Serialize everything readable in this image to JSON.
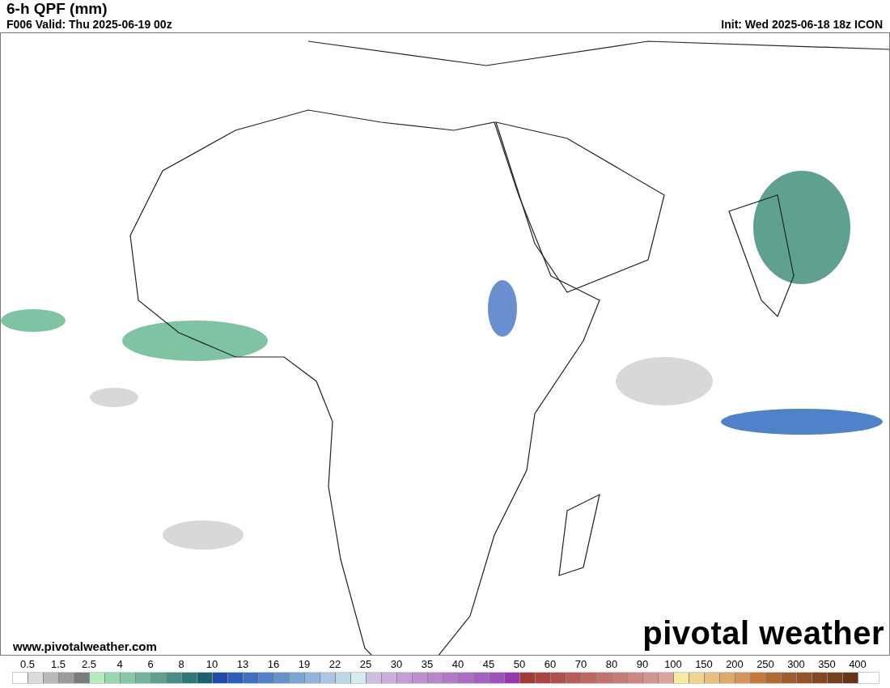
{
  "header": {
    "title": "6-h QPF (mm)",
    "valid": "F006 Valid: Thu 2025-06-19 00z",
    "init": "Init: Wed 2025-06-18 18z ICON"
  },
  "map": {
    "url": "www.pivotalweather.com",
    "logo": "pivotal weather"
  },
  "legend": {
    "labels": [
      "0.5",
      "1.5",
      "2.5",
      "4",
      "6",
      "8",
      "10",
      "13",
      "16",
      "19",
      "22",
      "25",
      "30",
      "35",
      "40",
      "45",
      "50",
      "60",
      "70",
      "80",
      "90",
      "100",
      "150",
      "200",
      "250",
      "300",
      "350",
      "400"
    ],
    "swatches": [
      {
        "color": "#ffffff"
      },
      {
        "color": "#dcdcdc"
      },
      {
        "color": "#b9b9b9"
      },
      {
        "color": "#9b9b9b"
      },
      {
        "color": "#7b7b7b"
      },
      {
        "color": "#b4ecbe"
      },
      {
        "color": "#98d8af"
      },
      {
        "color": "#86c8a8"
      },
      {
        "color": "#73b49c"
      },
      {
        "color": "#5fa190"
      },
      {
        "color": "#478d86"
      },
      {
        "color": "#2f787a"
      },
      {
        "color": "#186370"
      },
      {
        "color": "#1c4bb0"
      },
      {
        "color": "#2b5fbc"
      },
      {
        "color": "#3d6fc2"
      },
      {
        "color": "#5082c9"
      },
      {
        "color": "#6591cf"
      },
      {
        "color": "#7ea4d6"
      },
      {
        "color": "#93b5dd"
      },
      {
        "color": "#a9c6e3"
      },
      {
        "color": "#bed7e7"
      },
      {
        "color": "#d5ecee"
      },
      {
        "color": "#d0bde2"
      },
      {
        "color": "#cbaddb"
      },
      {
        "color": "#c49ed6"
      },
      {
        "color": "#bd91d1"
      },
      {
        "color": "#b986cd"
      },
      {
        "color": "#b27bc9"
      },
      {
        "color": "#ac6ec5"
      },
      {
        "color": "#a561c0"
      },
      {
        "color": "#9f52bb"
      },
      {
        "color": "#9a37b0"
      },
      {
        "color": "#a33a35"
      },
      {
        "color": "#ac4440"
      },
      {
        "color": "#b24f4b"
      },
      {
        "color": "#ba5b57"
      },
      {
        "color": "#c06762"
      },
      {
        "color": "#c4706b"
      },
      {
        "color": "#c97b76"
      },
      {
        "color": "#cf8783"
      },
      {
        "color": "#d49390"
      },
      {
        "color": "#dca09d"
      },
      {
        "color": "#f7ec9e"
      },
      {
        "color": "#efd587"
      },
      {
        "color": "#e8c079"
      },
      {
        "color": "#dfaa68"
      },
      {
        "color": "#d6955a"
      },
      {
        "color": "#c9783a"
      },
      {
        "color": "#b26a30"
      },
      {
        "color": "#a05c2c"
      },
      {
        "color": "#945427"
      },
      {
        "color": "#84471f"
      },
      {
        "color": "#773f1d"
      },
      {
        "color": "#663517"
      }
    ]
  }
}
